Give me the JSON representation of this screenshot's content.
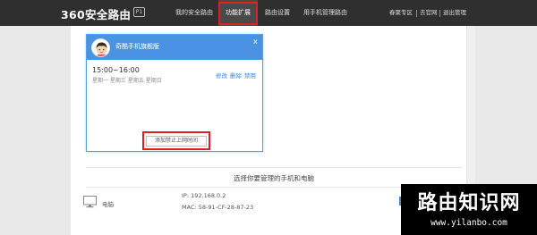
{
  "brand": {
    "logo_text": "360安全路由",
    "badge": "P1"
  },
  "nav": {
    "items": [
      {
        "label": "我的安全路由",
        "active": false
      },
      {
        "label": "功能扩展",
        "active": true
      },
      {
        "label": "路由设置",
        "active": false
      },
      {
        "label": "用手机管理路由",
        "active": false
      }
    ]
  },
  "top_right_links": [
    "春聚专区",
    "去官网",
    "退出管理"
  ],
  "card": {
    "title": "奇酷手机旗舰版",
    "close_glyph": "x",
    "rule": {
      "time_range": "15:00~16:00",
      "days": "星期一 星期三 星期五 星期日",
      "actions": [
        "修改",
        "删除",
        "禁用"
      ]
    },
    "add_button": "添加禁止上网时间"
  },
  "devices_section": {
    "title": "选择你要管理的手机和电脑",
    "devices": [
      {
        "icon": "desktop-computer-icon",
        "name": "电脑",
        "ip": "IP: 192.168.0.2",
        "mac": "MAC: 58-91-CF-28-87-23"
      }
    ]
  },
  "watermark": {
    "title": "路由知识网",
    "url": "www.yilanbo.com"
  },
  "colors": {
    "topbar": "#2f2f2f",
    "accent_blue": "#4a93e3",
    "highlight_red": "#e02020",
    "link_blue": "#3a86d8"
  }
}
